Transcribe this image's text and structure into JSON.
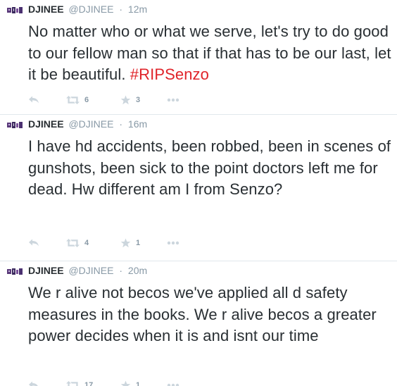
{
  "tweets": [
    {
      "fullname": "DJINEE",
      "username": "@DJINEE",
      "separator": "·",
      "time": "12m",
      "text": "No matter who or what we serve, let's try to do good to our fellow man so that if that has to be our last, let it be beautiful. ",
      "hashtag": "#RIPSenzo",
      "retweet_count": "6",
      "favorite_count": "3"
    },
    {
      "fullname": "DJINEE",
      "username": "@DJINEE",
      "separator": "·",
      "time": "16m",
      "text": "I have hd accidents, been robbed, been in scenes of gunshots, been sick to the point doctors left me for dead. Hw different am I from Senzo?",
      "retweet_count": "4",
      "favorite_count": "1"
    },
    {
      "fullname": "DJINEE",
      "username": "@DJINEE",
      "separator": "·",
      "time": "20m",
      "text": "We r alive not becos we've applied all d safety measures in the books. We r alive becos a greater power decides when it is and isnt our time",
      "retweet_count": "17",
      "favorite_count": "1"
    }
  ],
  "colors": {
    "text": "#292f33",
    "muted": "#8899a6",
    "icon": "#ccd6dd",
    "hashtag": "#e0242a",
    "divider": "#e1e8ed",
    "avatar": "#5a3a7a"
  },
  "icons": {
    "reply": "reply-icon",
    "retweet": "retweet-icon",
    "favorite": "star-icon",
    "more": "more-icon"
  }
}
